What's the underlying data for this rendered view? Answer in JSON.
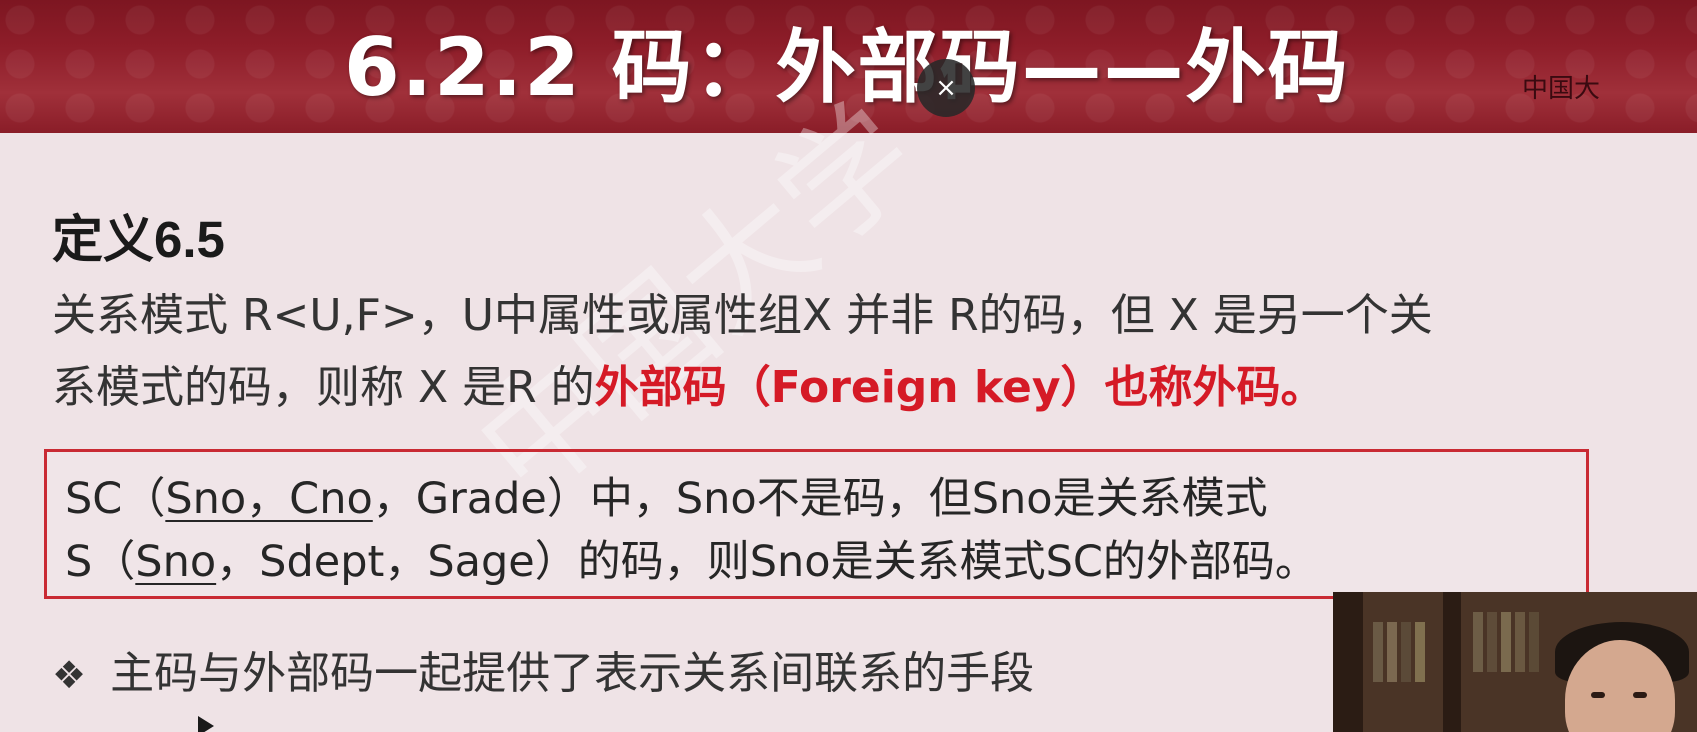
{
  "header": {
    "title": "6.2.2 码：外部码——外码",
    "logo_text": "中国大"
  },
  "overlay": {
    "close_icon": "×"
  },
  "watermark": {
    "text": "中国大学"
  },
  "definition": {
    "title": "定义6.5",
    "line1": "关系模式 R<U,F>，U中属性或属性组X 并非 R的码，但 X 是另一个关",
    "line2_plain": "系模式的码，则称 X 是R 的",
    "line2_red": "外部码（Foreign key）也称外码。"
  },
  "example": {
    "line1": {
      "prefix": "SC（",
      "underlined": "Sno，Cno",
      "suffix": "，Grade）中，Sno不是码，但Sno是关系模式"
    },
    "line2": {
      "prefix": "S（",
      "underlined": "Sno",
      "suffix": "，Sdept，Sage）的码，则Sno是关系模式SC的外部码。"
    }
  },
  "bullet": {
    "icon": "❖",
    "text": "主码与外部码一起提供了表示关系间联系的手段"
  },
  "colors": {
    "header_bg": "#8e1d29",
    "accent_red": "#d51a26",
    "box_border": "#c92a33",
    "slide_bg": "#efe3e6",
    "text": "#333333"
  }
}
